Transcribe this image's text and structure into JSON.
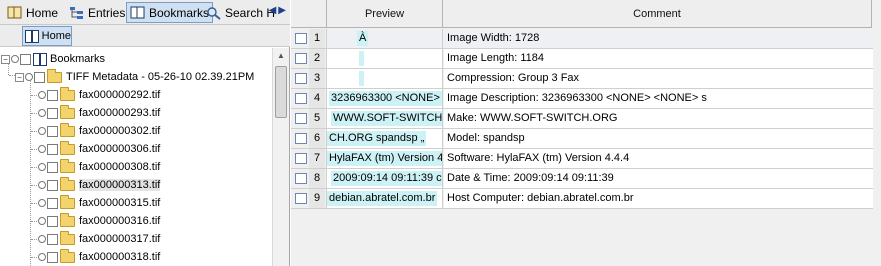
{
  "tabs": [
    {
      "label": "Home",
      "icon": "home-book-icon"
    },
    {
      "label": "Entries",
      "icon": "tree-icon"
    },
    {
      "label": "Bookmarks",
      "icon": "bookmark-book-icon"
    },
    {
      "label": "Search H",
      "icon": "search-icon"
    }
  ],
  "home_button": "Home",
  "tree": {
    "root": "Bookmarks",
    "folder": "TIFF Metadata - 05-26-10 02.39.21PM",
    "files": [
      "fax000000292.tif",
      "fax000000293.tif",
      "fax000000302.tif",
      "fax000000306.tif",
      "fax000000308.tif",
      "fax000000313.tif",
      "fax000000315.tif",
      "fax000000316.tif",
      "fax000000317.tif",
      "fax000000318.tif"
    ],
    "selected": "fax000000313.tif"
  },
  "table": {
    "headers": {
      "preview": "Preview",
      "comment": "Comment"
    },
    "rows": [
      {
        "num": "1",
        "preview": "À",
        "comment": "Image Width: 1728"
      },
      {
        "num": "2",
        "preview": "",
        "comment": "Image Length: 1184"
      },
      {
        "num": "3",
        "preview": "",
        "comment": "Compression: Group 3 Fax"
      },
      {
        "num": "4",
        "preview": "3236963300 <NONE>",
        "comment": "Image Description:  3236963300 <NONE> <NONE> s"
      },
      {
        "num": "5",
        "preview": "WWW.SOFT-SWITCH.",
        "comment": "Make: WWW.SOFT-SWITCH.ORG"
      },
      {
        "num": "6",
        "preview": "CH.ORG spandsp  „",
        "comment": "Model: spandsp"
      },
      {
        "num": "7",
        "preview": "HylaFAX (tm) Version 4",
        "comment": "Software: HylaFAX (tm) Version 4.4.4"
      },
      {
        "num": "8",
        "preview": "2009:09:14 09:11:39 c",
        "comment": "Date & Time: 2009:09:14 09:11:39"
      },
      {
        "num": "9",
        "preview": "debian.abratel.com.br",
        "comment": "Host Computer: debian.abratel.com.br"
      }
    ]
  }
}
